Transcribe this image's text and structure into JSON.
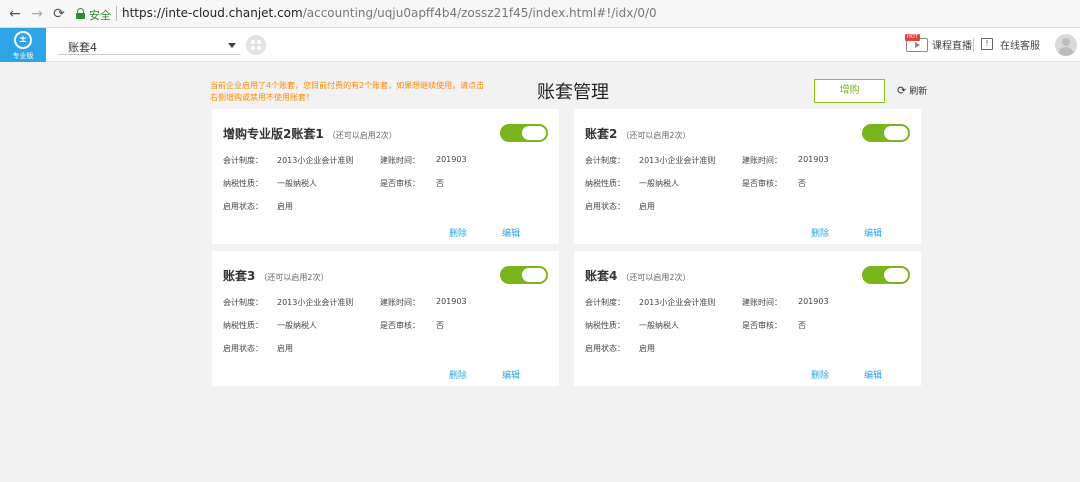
{
  "browser": {
    "secure_label": "安全",
    "url_host": "https://inte-cloud.chanjet.com",
    "url_path": "/accounting/uqju0apff4b4/zossz21f45/index.html#!/idx/0/0"
  },
  "header": {
    "logo_text": "专业版",
    "logo_glyph": "±",
    "account_selected": "账套4",
    "hot_badge": "HOT",
    "live_label": "课程直播",
    "service_icon_glyph": "!",
    "service_label": "在线客服"
  },
  "main": {
    "notice": "当前企业启用了4个账套，您目前付费的有2个账套，如果想继续使用，请点击右侧增购或禁用不使用账套！",
    "title": "账套管理",
    "buy_label": "增购",
    "refresh_icon": "⟳",
    "refresh_label": "刷新"
  },
  "cards": [
    {
      "title": "增购专业版2账套1",
      "note": "（还可以启用2次）",
      "enabled": true,
      "system_label": "会计制度：",
      "system_value": "2013小企业会计准则",
      "date_label": "建账时间：",
      "date_value": "201903",
      "tax_label": "纳税性质：",
      "tax_value": "一般纳税人",
      "audit_label": "是否审核：",
      "audit_value": "否",
      "status_label": "启用状态：",
      "status_value": "启用",
      "delete_label": "删除",
      "edit_label": "编辑"
    },
    {
      "title": "账套2",
      "note": "（还可以启用2次）",
      "enabled": true,
      "system_label": "会计制度：",
      "system_value": "2013小企业会计准则",
      "date_label": "建账时间：",
      "date_value": "201903",
      "tax_label": "纳税性质：",
      "tax_value": "一般纳税人",
      "audit_label": "是否审核：",
      "audit_value": "否",
      "status_label": "启用状态：",
      "status_value": "启用",
      "delete_label": "删除",
      "edit_label": "编辑"
    },
    {
      "title": "账套3",
      "note": "（还可以启用2次）",
      "enabled": true,
      "system_label": "会计制度：",
      "system_value": "2013小企业会计准则",
      "date_label": "建账时间：",
      "date_value": "201903",
      "tax_label": "纳税性质：",
      "tax_value": "一般纳税人",
      "audit_label": "是否审核：",
      "audit_value": "否",
      "status_label": "启用状态：",
      "status_value": "启用",
      "delete_label": "删除",
      "edit_label": "编辑"
    },
    {
      "title": "账套4",
      "note": "（还可以启用2次）",
      "enabled": true,
      "system_label": "会计制度：",
      "system_value": "2013小企业会计准则",
      "date_label": "建账时间：",
      "date_value": "201903",
      "tax_label": "纳税性质：",
      "tax_value": "一般纳税人",
      "audit_label": "是否审核：",
      "audit_value": "否",
      "status_label": "启用状态：",
      "status_value": "启用",
      "delete_label": "删除",
      "edit_label": "编辑"
    }
  ],
  "colors": {
    "accent_blue": "#2fa4e7",
    "toggle_green": "#7ab51d",
    "notice_orange": "#ff8a00"
  }
}
